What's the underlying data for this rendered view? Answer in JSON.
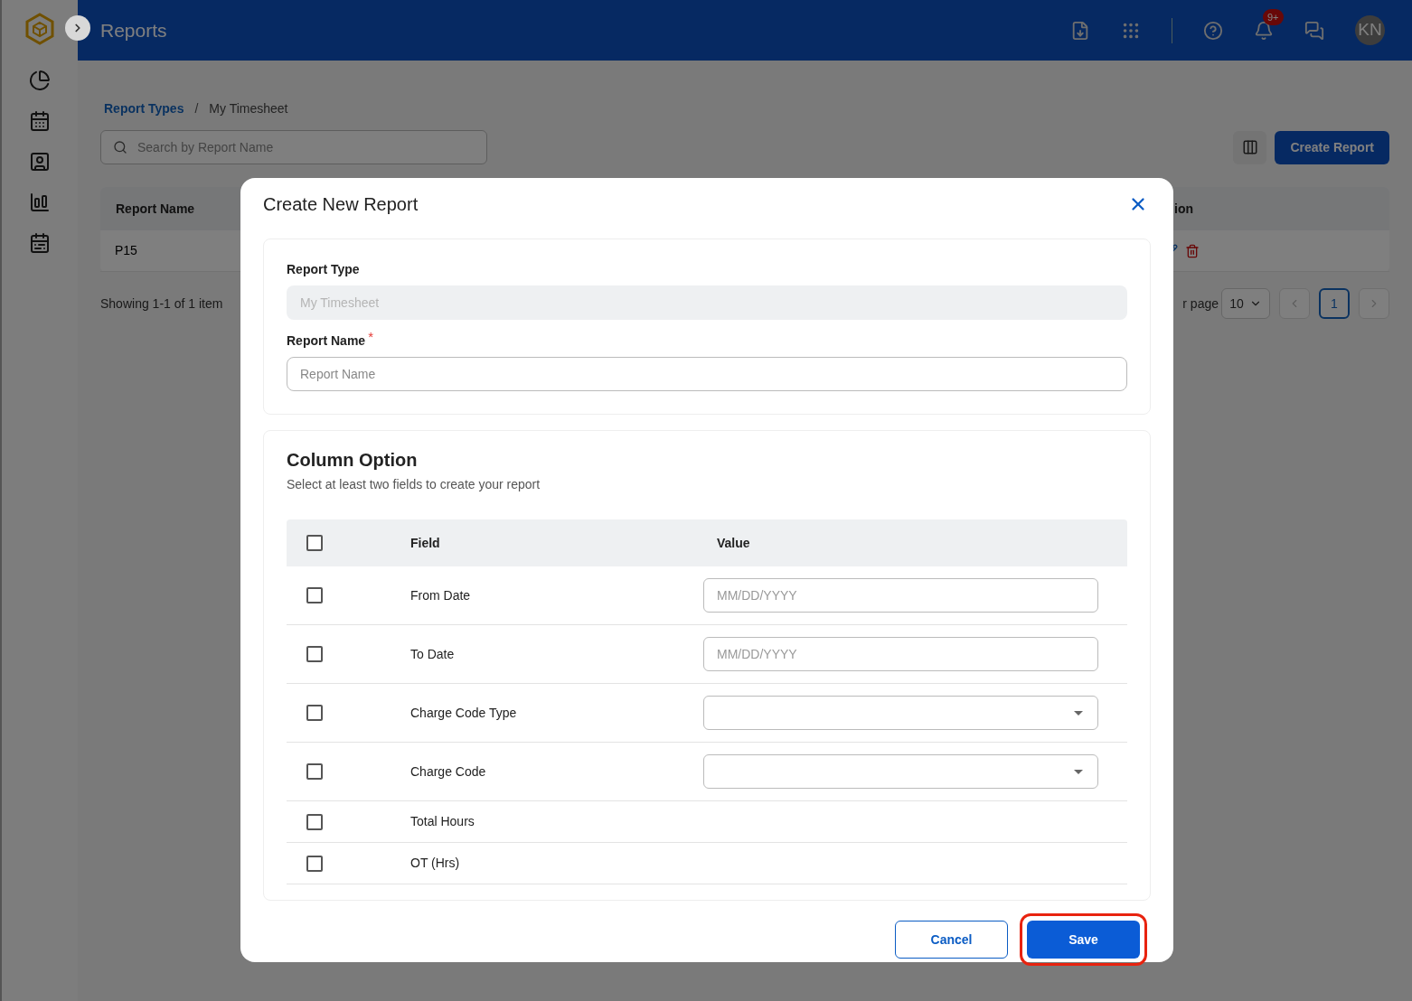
{
  "app": {
    "title": "Reports",
    "notification_badge": "9+",
    "avatar": "KN"
  },
  "breadcrumb": [
    {
      "label": "Report Types",
      "kind": "link"
    },
    {
      "label": "My Timesheet",
      "kind": "current"
    }
  ],
  "breadcrumb_separator": "/",
  "search": {
    "placeholder": "Search by Report Name"
  },
  "create_button": "Create Report",
  "table": {
    "columns": [
      "Report Name",
      "ion"
    ],
    "rows": [
      {
        "name": "P15"
      }
    ]
  },
  "footer": {
    "summary": "Showing 1-1 of 1 item",
    "per_page_label": "r page",
    "per_page": "10",
    "pages": [
      {
        "label": "1",
        "selected": true
      }
    ]
  },
  "dialog": {
    "title": "Create New Report",
    "report_type": {
      "label": "Report Type",
      "value": "My Timesheet",
      "disabled": true
    },
    "report_name": {
      "label": "Report Name",
      "required_mark": "*",
      "placeholder": "Report Name"
    },
    "column_option": {
      "title": "Column Option",
      "subtitle": "Select at least two fields to create your report",
      "select_all": {
        "checked": false
      },
      "columns": [
        "Field",
        "Value"
      ],
      "rows": [
        {
          "field": "From Date",
          "checked": false,
          "kind": "date",
          "placeholder": "MM/DD/YYYY"
        },
        {
          "field": "To Date",
          "checked": false,
          "kind": "date",
          "placeholder": "MM/DD/YYYY"
        },
        {
          "field": "Charge Code Type",
          "checked": false,
          "kind": "select"
        },
        {
          "field": "Charge Code",
          "checked": false,
          "kind": "select"
        },
        {
          "field": "Total Hours",
          "checked": false,
          "kind": "plain"
        },
        {
          "field": "OT (Hrs)",
          "checked": false,
          "kind": "plain"
        }
      ]
    },
    "buttons": {
      "cancel": "Cancel",
      "save": "Save",
      "save_highlighted": true
    }
  }
}
